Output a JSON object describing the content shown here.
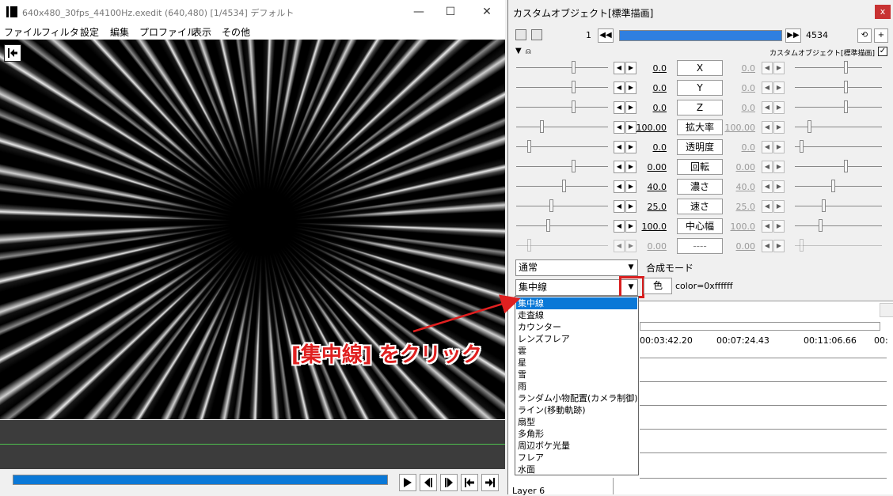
{
  "left_window": {
    "title": "640x480_30fps_44100Hz.exedit (640,480)  [1/4534]  デフォルト",
    "menu": [
      "ファイル",
      "フィルタ",
      "設定",
      "編集",
      "プロファイル",
      "表示",
      "その他"
    ],
    "window_buttons": [
      "—",
      "☐",
      "✕"
    ]
  },
  "annotation": {
    "text": "[集中線] をクリック",
    "color": "#e02020"
  },
  "panel": {
    "title": "カスタムオブジェクト[標準描画]",
    "close": "x",
    "frame_start": "1",
    "frame_end": "4534",
    "header_label": "カスタムオブジェクト[標準描画]",
    "params": [
      {
        "name": "X",
        "left": "0.0",
        "right": "0.0",
        "enabled": true
      },
      {
        "name": "Y",
        "left": "0.0",
        "right": "0.0",
        "enabled": true
      },
      {
        "name": "Z",
        "left": "0.0",
        "right": "0.0",
        "enabled": true
      },
      {
        "name": "拡大率",
        "left": "100.00",
        "right": "100.00",
        "enabled": true
      },
      {
        "name": "透明度",
        "left": "0.0",
        "right": "0.0",
        "enabled": true
      },
      {
        "name": "回転",
        "left": "0.00",
        "right": "0.00",
        "enabled": true
      },
      {
        "name": "濃さ",
        "left": "40.0",
        "right": "40.0",
        "enabled": true
      },
      {
        "name": "速さ",
        "left": "25.0",
        "right": "25.0",
        "enabled": true
      },
      {
        "name": "中心幅",
        "left": "100.0",
        "right": "100.0",
        "enabled": true
      },
      {
        "name": "----",
        "left": "0.00",
        "right": "0.00",
        "enabled": false
      }
    ],
    "blend_mode": "通常",
    "blend_label": "合成モード",
    "object_type": "集中線",
    "color_button": "色",
    "color_text": "color=0xffffff"
  },
  "timeline": {
    "times": [
      "00:03:42.20",
      "00:07:24.43",
      "00:11:06.66",
      "00:"
    ],
    "layer_label": "Layer 6"
  },
  "dropdown_items": [
    "集中線",
    "走査線",
    "カウンター",
    "レンズフレア",
    "雲",
    "星",
    "雪",
    "雨",
    "ランダム小物配置(カメラ制御)",
    "ライン(移動軌跡)",
    "扇型",
    "多角形",
    "周辺ボケ光量",
    "フレア",
    "水面"
  ],
  "dropdown_selected": "集中線"
}
